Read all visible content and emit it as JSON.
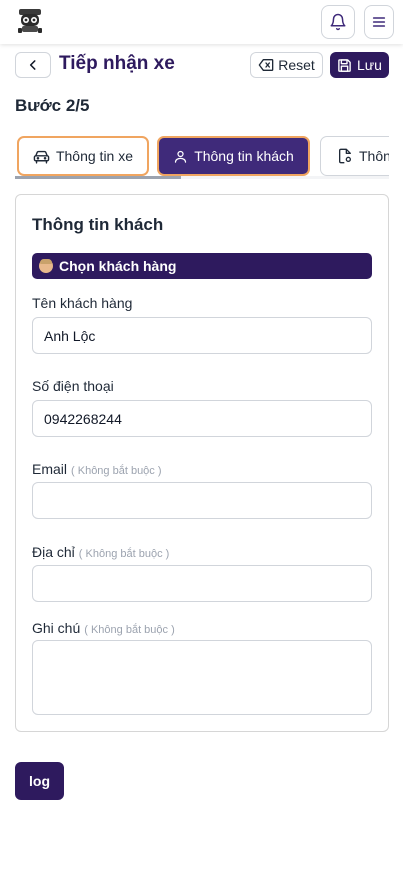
{
  "header": {
    "logo_icon": "car-mascot-logo-icon",
    "bell_icon": "bell-icon",
    "menu_icon": "hamburger-menu-icon"
  },
  "toolbar": {
    "back_icon": "chevron-left-icon",
    "title": "Tiếp nhận xe",
    "reset_label": "Reset",
    "reset_icon": "backspace-icon",
    "save_label": "Lưu",
    "save_icon": "floppy-disk-icon"
  },
  "step": {
    "label": "Bước 2/5",
    "current": 2,
    "total": 5
  },
  "tabs": [
    {
      "label": "Thông tin xe",
      "icon": "car-icon",
      "active": false
    },
    {
      "label": "Thông tin khách",
      "icon": "user-icon",
      "active": true
    },
    {
      "label": "Thông",
      "icon": "document-gear-icon",
      "active": false
    }
  ],
  "form": {
    "title": "Thông tin khách",
    "choose_customer_label": "Chọn khách hàng",
    "choose_customer_icon": "face-emoji-icon",
    "fields": {
      "name": {
        "label": "Tên khách hàng",
        "optional": "",
        "value": "Anh Lộc"
      },
      "phone": {
        "label": "Số điện thoại",
        "optional": "",
        "value": "0942268244"
      },
      "email": {
        "label": "Email",
        "optional": "( Không bắt buộc )",
        "value": ""
      },
      "address": {
        "label": "Địa chỉ",
        "optional": "( Không bắt buộc )",
        "value": ""
      },
      "note": {
        "label": "Ghi chú",
        "optional": "( Không bắt buộc )",
        "value": ""
      }
    }
  },
  "log_button_label": "log",
  "colors": {
    "primary": "#2e1a5e",
    "active_tab": "#3f2a7a",
    "tab_border": "#f0a560",
    "border": "#d1d5db"
  }
}
